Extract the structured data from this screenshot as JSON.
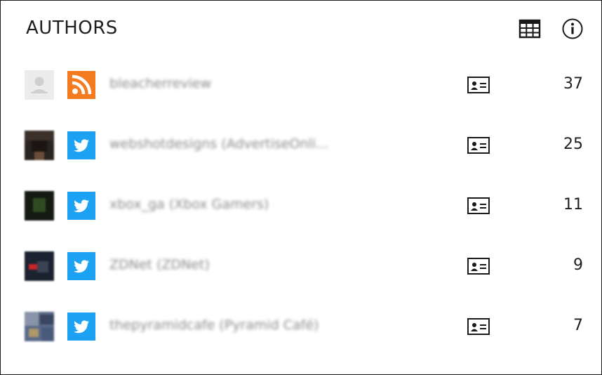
{
  "panel": {
    "title": "AUTHORS",
    "header_icons": [
      "table-view-icon",
      "info-icon"
    ]
  },
  "authors": [
    {
      "avatar": "default-avatar",
      "source": "rss",
      "name": "bleacherreview",
      "count": "37"
    },
    {
      "avatar": "photo-avatar",
      "source": "twitter",
      "name": "webshotdesigns (AdvertiseOnli...",
      "count": "25"
    },
    {
      "avatar": "photo-avatar",
      "source": "twitter",
      "name": "xbox_ga (Xbox Gamers)",
      "count": "11"
    },
    {
      "avatar": "photo-avatar",
      "source": "twitter",
      "name": "ZDNet (ZDNet)",
      "count": "9"
    },
    {
      "avatar": "photo-avatar",
      "source": "twitter",
      "name": "thepyramidcafe (Pyramid Café)",
      "count": "7"
    }
  ],
  "colors": {
    "rss_orange": "#f47b20",
    "twitter_blue": "#1da1f2",
    "text_dark": "#1f1f1f",
    "name_gray": "#8a8a8a"
  }
}
